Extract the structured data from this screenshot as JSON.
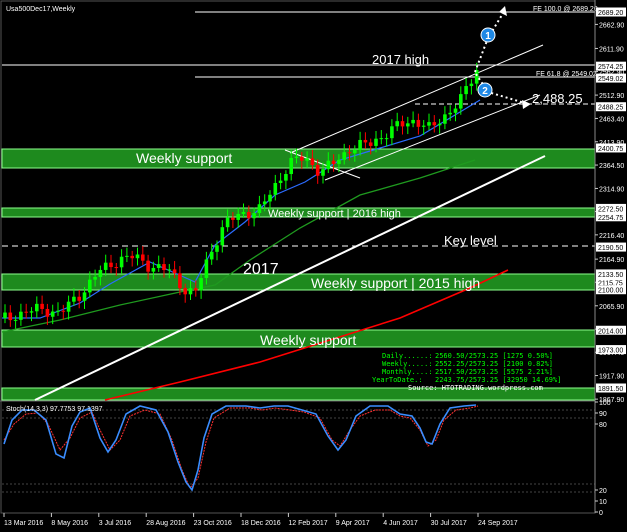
{
  "window": {
    "title": "Usa500Dec17,Weekly"
  },
  "price_axis": {
    "ticks": [
      "2662.90",
      "2611.90",
      "2562.90",
      "2512.90",
      "2463.40",
      "2413.90",
      "2364.50",
      "2314.90",
      "2265.90",
      "2216.40",
      "2164.90",
      "2115.90",
      "2065.90",
      "2016.40",
      "1967.40",
      "1917.90",
      "1867.90"
    ],
    "markers": [
      {
        "text": "2689.20",
        "color": "#000000",
        "bg": "#ffffff"
      },
      {
        "text": "2574.25",
        "color": "#000000",
        "bg": "#ffffff"
      },
      {
        "text": "2549.02",
        "color": "#000000",
        "bg": "#ffffff"
      },
      {
        "text": "2488.25",
        "color": "#000000",
        "bg": "#ffffff"
      },
      {
        "text": "2400.75",
        "color": "#000000",
        "bg": "#ffffff"
      },
      {
        "text": "2272.50",
        "color": "#000000",
        "bg": "#ffffff"
      },
      {
        "text": "2254.75",
        "color": "#000000",
        "bg": "#ffffff"
      },
      {
        "text": "2190.50",
        "color": "#000000",
        "bg": "#ffffff"
      },
      {
        "text": "2133.50",
        "color": "#000000",
        "bg": "#ffffff"
      },
      {
        "text": "2115.75",
        "color": "#000000",
        "bg": "#ffffff"
      },
      {
        "text": "2100.00",
        "color": "#000000",
        "bg": "#ffffff"
      },
      {
        "text": "2014.00",
        "color": "#000000",
        "bg": "#ffffff"
      },
      {
        "text": "1973.00",
        "color": "#000000",
        "bg": "#ffffff"
      },
      {
        "text": "1891.50",
        "color": "#000000",
        "bg": "#ffffff"
      }
    ]
  },
  "stoch_axis": {
    "ticks": [
      "100",
      "90",
      "80",
      "20",
      "10",
      "0"
    ]
  },
  "time_axis": {
    "ticks": [
      "13 Mar 2016",
      "8 May 2016",
      "3 Jul 2016",
      "28 Aug 2016",
      "23 Oct 2016",
      "18 Dec 2016",
      "12 Feb 2017",
      "9 Apr 2017",
      "4 Jun 2017",
      "30 Jul 2017",
      "24 Sep 2017"
    ]
  },
  "annotations": {
    "fe100": "FE 100.0 @ 2689.20",
    "fe618": "FE 61.8 @ 2549.02",
    "high2017": "2017 high",
    "level2488": "2,488.25",
    "weekly_support_1": "Weekly support",
    "weekly_support_2016": "Weekly support | 2016 high",
    "key_level": "Key level",
    "year_2017": "2017",
    "weekly_support_2015": "Weekly support | 2015 high",
    "weekly_support_3": "Weekly support",
    "wave1": "1",
    "wave2": "2"
  },
  "info_box": {
    "rows": [
      {
        "label": "Daily......:",
        "value": "2560.50/2573.25  [1275 0.50%]"
      },
      {
        "label": "Weekly.....:",
        "value": "2552.25/2573.25  [2100 0.82%]"
      },
      {
        "label": "Monthly....:",
        "value": "2517.50/2573.25  [5575 2.21%]"
      },
      {
        "label": "YearToDate.:",
        "value": "2243.75/2573.25  [32950 14.69%]"
      }
    ],
    "source": "Source: HTOTRADING.wordpress.com"
  },
  "stoch": {
    "label": "Stoch(14,3,3) 97.7753 97.1397"
  },
  "colors": {
    "background": "#000000",
    "bull": "#00ff00",
    "bear": "#ff0000",
    "zone": "#1e8a1e",
    "zone_border": "#8cff8c",
    "ma_fast": "#2b6cff",
    "ma_mid": "#1f9a1f",
    "ma_slow": "#ff0000",
    "trendline": "#ffffff",
    "stoch_main": "#3a8dff",
    "stoch_signal": "#ff3030",
    "accent_badge": "#1e88e5"
  }
}
